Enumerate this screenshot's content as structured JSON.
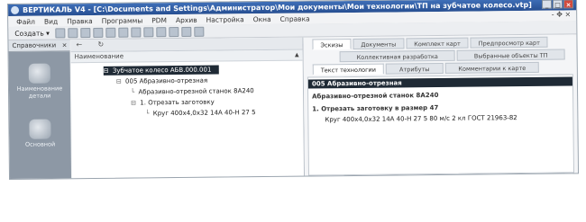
{
  "window": {
    "title": "ВЕРТИКАЛЬ V4 - [C:\\Documents and Settings\\Администратор\\Мои документы\\Мои технологии\\ТП на зубчатое колесо.vtp]",
    "buttons": [
      "_",
      "□",
      "×"
    ]
  },
  "menu": {
    "items": [
      "Файл",
      "Вид",
      "Правка",
      "Программы",
      "PDM",
      "Архив",
      "Настройка",
      "Окна",
      "Справка"
    ],
    "right": "- ✥ ×"
  },
  "toolbar": {
    "create_label": "Создать ▾"
  },
  "sidebar": {
    "header": "Справочники",
    "close": "×",
    "items": [
      {
        "label": "Наименование детали",
        "icon": "part-icon"
      },
      {
        "label": "Основной",
        "icon": "gear-icon"
      }
    ]
  },
  "tree": {
    "nav_back": "←",
    "nav_forward": "↻",
    "column_header": "Наименование",
    "rows": [
      {
        "icon": "⊟",
        "text": "Зубчатое колесо АБВ.000.001"
      },
      {
        "icon": "⊟",
        "text": "005 Абразивно-отрезная"
      },
      {
        "icon": "└",
        "text": "Абразивно-отрезной станок 8А240"
      },
      {
        "icon": "⊟",
        "text": "1. Отрезать заготовку"
      },
      {
        "icon": "└",
        "text": "Круг 400х4,0х32 14А 40-Н 27 5"
      }
    ]
  },
  "right": {
    "tabs_row1": [
      "Эскизы",
      "Документы",
      "Комплект карт",
      "Предпросмотр карт"
    ],
    "tabs_row2": [
      "Коллективная разработка",
      "Выбранные объекты ТП"
    ],
    "tabs_row3": [
      "Текст технологии",
      "Атрибуты",
      "Комментарии к карте"
    ],
    "content_lines": [
      "005 Абразивно-отрезная",
      "Абразивно-отрезной станок 8А240",
      "1. Отрезать заготовку в размер 47",
      "Круг 400х4,0х32 14А 40-Н 27 5   80 м/с 2 кл ГОСТ 21963-82"
    ]
  }
}
